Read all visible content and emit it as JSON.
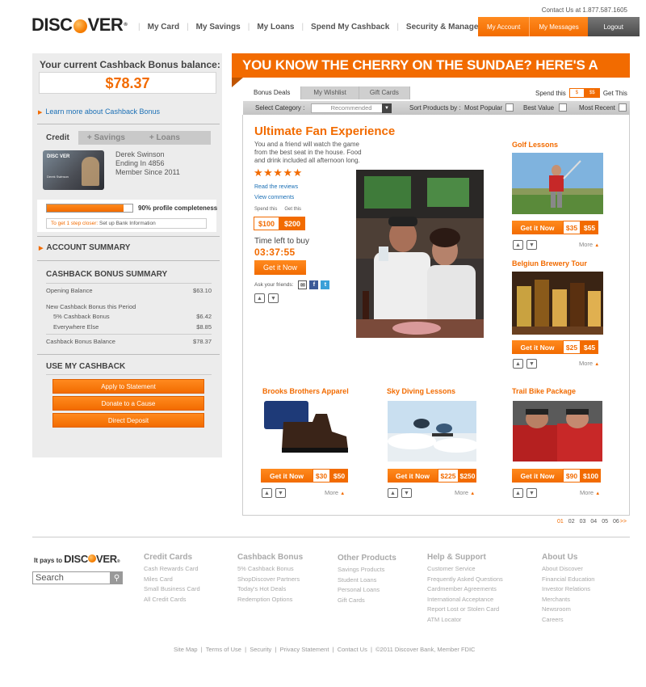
{
  "header": {
    "contact": "Contact Us at 1.877.587.1605",
    "logo": "DISC",
    "logo_rest": "VER",
    "nav": [
      "My Card",
      "My Savings",
      "My Loans",
      "Spend My Cashback",
      "Security & Management"
    ],
    "my_account": "My Account",
    "my_messages": "My Messages",
    "logout": "Logout"
  },
  "sidebar": {
    "balance_title": "Your current Cashback Bonus balance:",
    "balance": "$78.37",
    "learn_more": "Learn more about Cashback Bonus",
    "tabs": [
      "Credit",
      "+ Savings",
      "+ Loans"
    ],
    "card_logo": "DISC VER",
    "card_name_small": "Derek Swinson",
    "holder_name": "Derek Swinson",
    "holder_ending": "Ending In 4856",
    "holder_since": "Member Since 2011",
    "profile_completeness": 0.9,
    "profile_text": "90% profile completeness",
    "step_prefix": "To get 1 step closer:",
    "step_action": "Set up Bank Information",
    "account_summary": "ACCOUNT SUMMARY",
    "cashback_summary": "CASHBACK BONUS SUMMARY",
    "rows": [
      {
        "label": "Opening Balance",
        "value": "$63.10"
      },
      {
        "label": "New Cashback Bonus this Period",
        "value": ""
      },
      {
        "label": "5% Cashback Bonus",
        "value": "$6.42"
      },
      {
        "label": "Everywhere Else",
        "value": "$8.85"
      },
      {
        "label": "Cashback Bonus Balance",
        "value": "$78.37"
      }
    ],
    "use_cashback": "USE MY CASHBACK",
    "buttons": [
      "Apply to Statement",
      "Donate to a Cause",
      "Direct Deposit"
    ]
  },
  "main": {
    "banner": "YOU KNOW THE CHERRY ON THE SUNDAE? HERE'S A BUNCH.",
    "tabs": [
      "Bonus Deals",
      "My Wishlist",
      "Gift Cards"
    ],
    "spend_this": "Spend this",
    "spend_a": "$",
    "spend_b": "$$",
    "get_this": "Get This",
    "select_category": "Select Category :",
    "category_value": "Recommended",
    "sort_by": "Sort Products by :",
    "sort_options": [
      "Most Popular",
      "Best Value",
      "Most Recent"
    ],
    "featured": {
      "title": "Ultimate Fan Experience",
      "desc": "You and a friend  will watch the game from the best seat in the house. Food and drink included all afternoon long.",
      "stars": "★★★★★",
      "read_reviews": "Read the reviews",
      "view_comments": "View comments",
      "spend_lbl": "Spend this",
      "get_lbl": "Get this",
      "spend": "$100",
      "get": "$200",
      "time_left": "Time left to buy",
      "timer": "03:37:55",
      "button": "Get it Now",
      "ask_friends": "Ask your friends:"
    },
    "deals": [
      {
        "title": "Golf Lessons",
        "spend": "$35",
        "get": "$55"
      },
      {
        "title": "Belgiun Brewery Tour",
        "spend": "$25",
        "get": "$45"
      },
      {
        "title": "Brooks Brothers Apparel",
        "spend": "$30",
        "get": "$50"
      },
      {
        "title": "Sky Diving Lessons",
        "spend": "$225",
        "get": "$250"
      },
      {
        "title": "Trail Bike Package",
        "spend": "$90",
        "get": "$100"
      }
    ],
    "get_it_now": "Get it Now",
    "more": "More",
    "pages": [
      "01",
      "02",
      "03",
      "04",
      "05",
      "06",
      ">>"
    ]
  },
  "footer": {
    "tagline": "It pays to",
    "brand": "DISC",
    "brand_rest": "VER",
    "search_placeholder": "Search",
    "columns": [
      {
        "title": "Credit Cards",
        "items": [
          "Cash Rewards Card",
          "Miles Card",
          "Small Business Card",
          "All Credit Cards"
        ]
      },
      {
        "title": "Cashback Bonus",
        "items": [
          "5% Cashback Bonus",
          "ShopDiscover Partners",
          "Today's Hot Deals",
          "Redemption Options"
        ]
      },
      {
        "title": "Other Products",
        "items": [
          "Savings Products",
          "Student Loans",
          "Personal Loans",
          "Gift Cards"
        ]
      },
      {
        "title": "Help & Support",
        "items": [
          "Customer Service",
          "Frequently Asked Questions",
          "Cardmember Agreements",
          "International Acceptance",
          "Report Lost or Stolen Card",
          "ATM Locator"
        ]
      },
      {
        "title": "About Us",
        "items": [
          "About Discover",
          "Financial Education",
          "Investor Relations",
          "Merchants",
          "Newsroom",
          "Careers"
        ]
      }
    ],
    "legal": "Site Map  |  Terms of Use  |  Security  |  Privacy Statement  |  Contact Us  |  ©2011 Discover Bank, Member FDIC"
  }
}
